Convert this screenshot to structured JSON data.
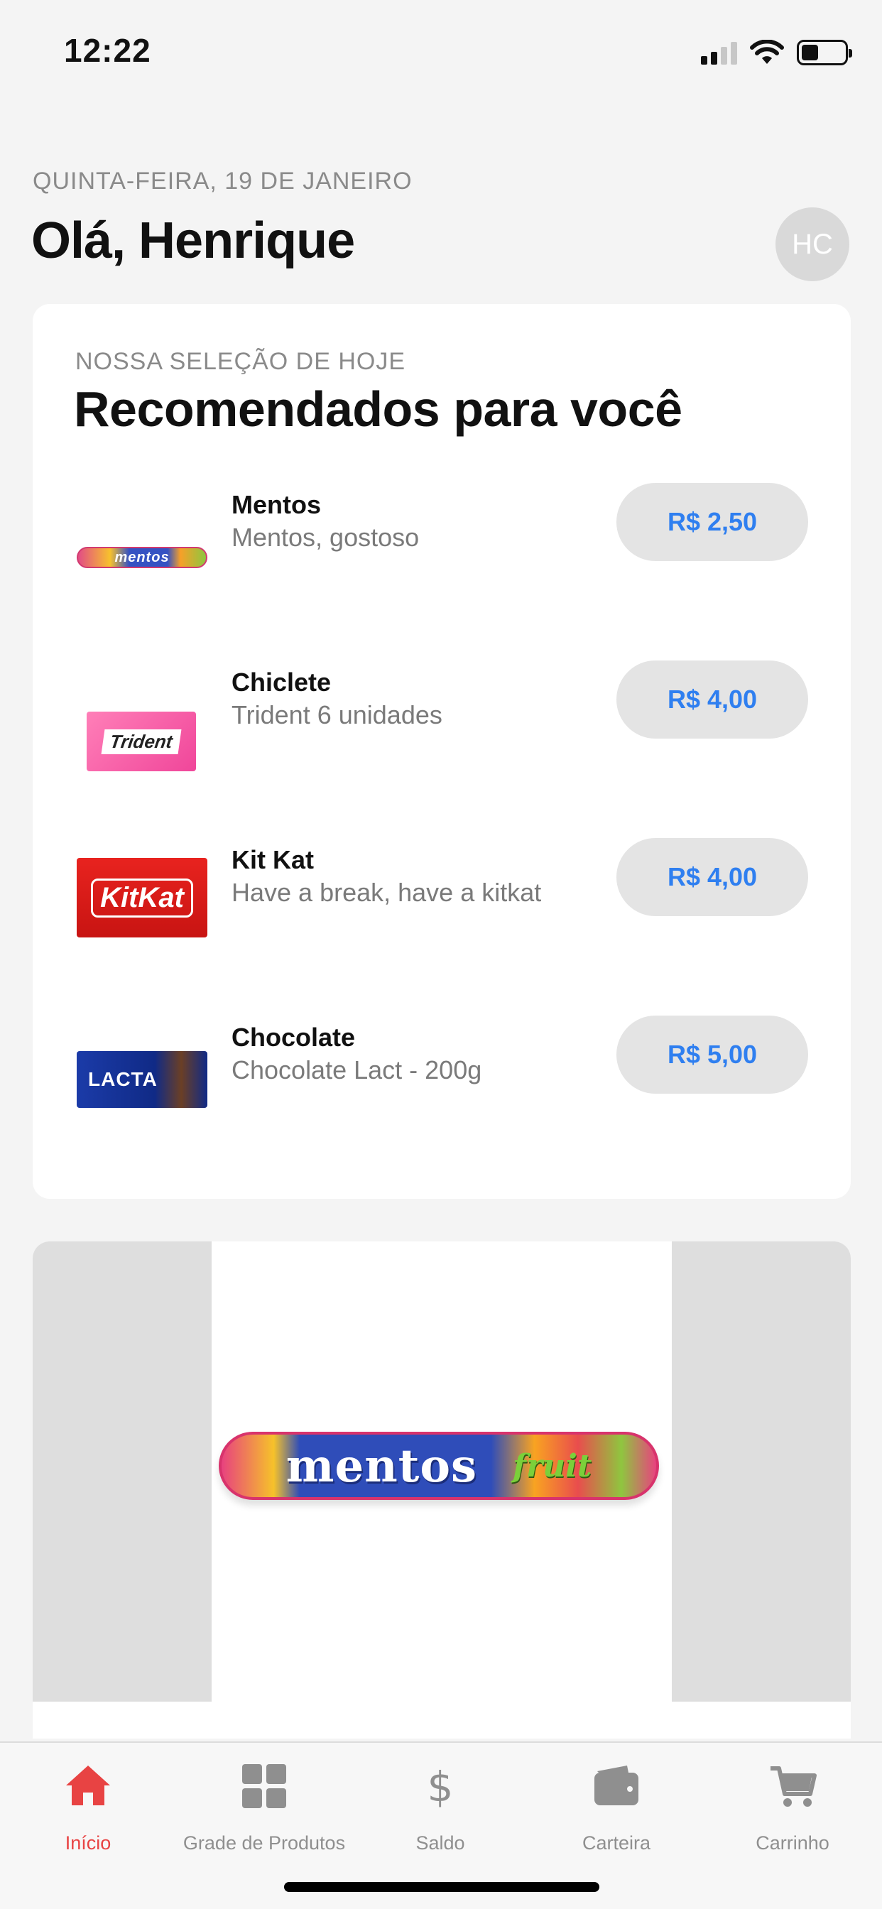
{
  "status_bar": {
    "time": "12:22",
    "signal_icon": "cellular-signal-icon",
    "wifi_icon": "wifi-icon",
    "battery_icon": "battery-icon",
    "battery_level": 0.4
  },
  "header": {
    "date": "QUINTA-FEIRA, 19 DE JANEIRO",
    "greeting": "Olá, Henrique",
    "avatar_initials": "HC"
  },
  "recommendations": {
    "eyebrow": "NOSSA SELEÇÃO DE HOJE",
    "title": "Recomendados para você",
    "items": [
      {
        "name": "Mentos",
        "description": "Mentos, gostoso",
        "price": "R$ 2,50",
        "thumb_text": "mentos"
      },
      {
        "name": "Chiclete",
        "description": "Trident 6 unidades",
        "price": "R$ 4,00",
        "thumb_text": "Trident"
      },
      {
        "name": "Kit Kat",
        "description": "Have a break, have a kitkat",
        "price": "R$ 4,00",
        "thumb_text": "KitKat"
      },
      {
        "name": "Chocolate",
        "description": "Chocolate Lact - 200g",
        "price": "R$ 5,00",
        "thumb_text": "LACTA"
      }
    ]
  },
  "banner": {
    "brand": "mentos",
    "flavor": "fruit"
  },
  "tab_bar": {
    "tabs": [
      {
        "label": "Início",
        "icon": "home-icon",
        "active": true
      },
      {
        "label": "Grade de Produtos",
        "icon": "grid-icon",
        "active": false
      },
      {
        "label": "Saldo",
        "icon": "dollar-icon",
        "active": false
      },
      {
        "label": "Carteira",
        "icon": "wallet-icon",
        "active": false
      },
      {
        "label": "Carrinho",
        "icon": "cart-icon",
        "active": false
      }
    ]
  },
  "colors": {
    "accent": "#e84343",
    "price_text": "#2f7ff0",
    "background": "#f4f4f4"
  }
}
